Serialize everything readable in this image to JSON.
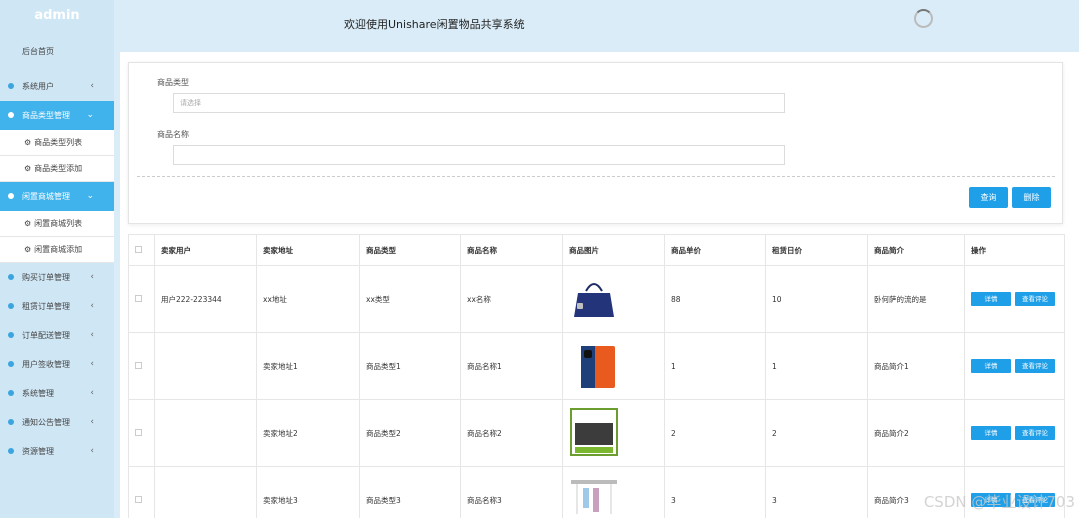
{
  "sidebar": {
    "brand": "admin",
    "home": "后台首页",
    "items": [
      {
        "label": "系统用户",
        "active": false
      },
      {
        "label": "商品类型管理",
        "active": true,
        "children": [
          "商品类型列表",
          "商品类型添加"
        ]
      },
      {
        "label": "闲置商城管理",
        "active": true,
        "children": [
          "闲置商城列表",
          "闲置商城添加"
        ]
      },
      {
        "label": "购买订单管理",
        "active": false
      },
      {
        "label": "租赁订单管理",
        "active": false
      },
      {
        "label": "订单配送管理",
        "active": false
      },
      {
        "label": "用户签收管理",
        "active": false
      },
      {
        "label": "系统管理",
        "active": false
      },
      {
        "label": "通知公告管理",
        "active": false
      },
      {
        "label": "资源管理",
        "active": false
      }
    ]
  },
  "header": {
    "welcome": "欢迎使用Unishare闲置物品共享系统"
  },
  "search": {
    "type_label": "商品类型",
    "type_placeholder": "请选择",
    "name_label": "商品名称",
    "name_value": "",
    "query_button": "查询",
    "delete_button": "删除"
  },
  "table": {
    "headers": [
      "卖家用户",
      "卖家地址",
      "商品类型",
      "商品名称",
      "商品图片",
      "商品单价",
      "租赁日价",
      "商品简介",
      "操作"
    ],
    "detail_label": "详情",
    "review_label": "查看评论",
    "rows": [
      {
        "user": "用户222-223344",
        "address": "xx地址",
        "type": "xx类型",
        "name": "xx名称",
        "image": "bag",
        "price": "88",
        "daily": "10",
        "intro": "卧何萨的流的是"
      },
      {
        "user": "",
        "address": "卖家地址1",
        "type": "商品类型1",
        "name": "商品名称1",
        "image": "phone",
        "price": "1",
        "daily": "1",
        "intro": "商品简介1"
      },
      {
        "user": "",
        "address": "卖家地址2",
        "type": "商品类型2",
        "name": "商品名称2",
        "image": "tv",
        "price": "2",
        "daily": "2",
        "intro": "商品简介2"
      },
      {
        "user": "",
        "address": "卖家地址3",
        "type": "商品类型3",
        "name": "商品名称3",
        "image": "rack",
        "price": "3",
        "daily": "3",
        "intro": "商品简介3"
      }
    ]
  },
  "watermark": "CSDN @毕业设计703",
  "colors": {
    "accent": "#1e9fe8",
    "sidebar_active": "#40b2ec",
    "sidebar_bg": "#cfe6f5"
  }
}
